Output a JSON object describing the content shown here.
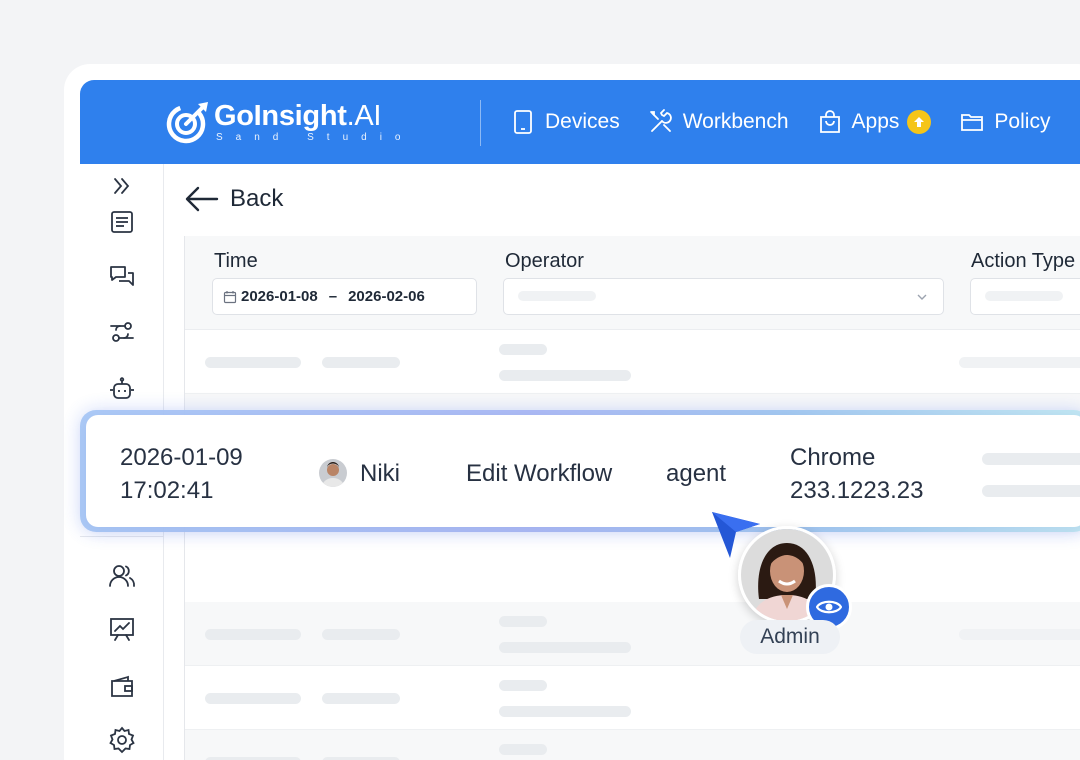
{
  "brand": {
    "name_main": "GoInsight",
    "name_suffix": ".AI",
    "tagline": "Sand Studio"
  },
  "nav": {
    "items": [
      {
        "label": "Devices",
        "icon": "tablet-icon"
      },
      {
        "label": "Workbench",
        "icon": "tools-icon"
      },
      {
        "label": "Apps",
        "icon": "bag-icon",
        "badge": "upload-badge-icon"
      },
      {
        "label": "Policy",
        "icon": "folder-icon"
      }
    ]
  },
  "sidebar": {
    "icons": [
      "expand-icon",
      "document-icon",
      "chat-icon",
      "workflow-icon",
      "robot-icon",
      "users-icon",
      "presentation-chart-icon",
      "wallet-icon",
      "gear-icon"
    ]
  },
  "back_label": "Back",
  "filters": {
    "time_label": "Time",
    "date_from": "2026-01-08",
    "date_separator": "–",
    "date_to": "2026-02-06",
    "operator_label": "Operator",
    "action_type_label": "Action Type"
  },
  "highlight_row": {
    "date": "2026-01-09",
    "time": "17:02:41",
    "operator": "Niki",
    "action": "Edit Workflow",
    "target": "agent",
    "browser": "Chrome",
    "ip": "233.1223.23"
  },
  "viewer": {
    "label": "Admin"
  },
  "colors": {
    "header": "#2f80ed",
    "accent": "#2f6ae0",
    "badge": "#f5c518"
  }
}
